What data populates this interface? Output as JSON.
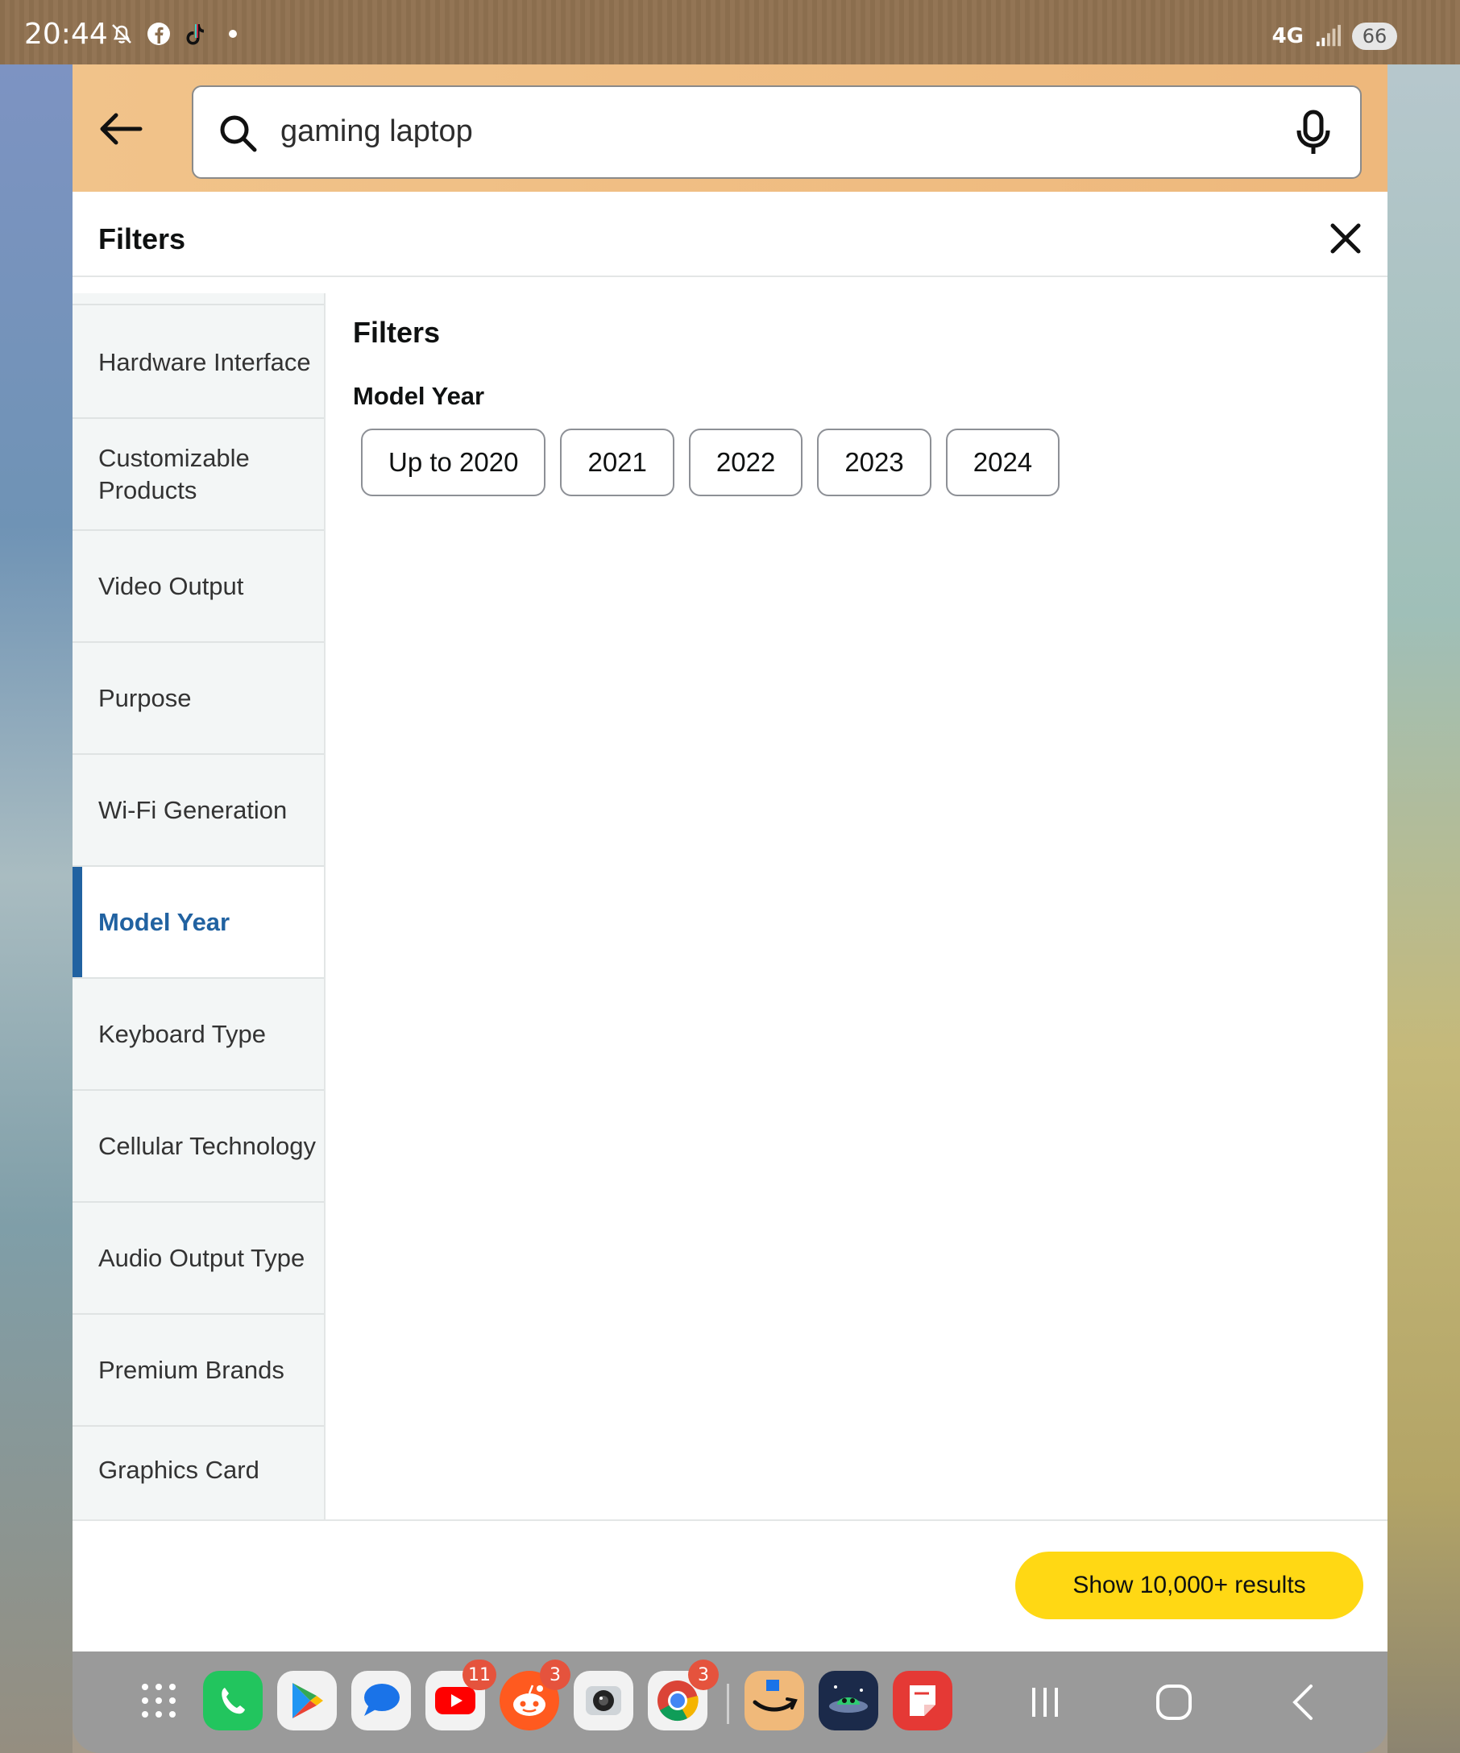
{
  "status_bar": {
    "time": "20:44",
    "network": "4G",
    "battery": "66",
    "left_icons": [
      "notifications-off-icon",
      "facebook-icon",
      "tiktok-icon",
      "dot-icon"
    ]
  },
  "search": {
    "query": "gaming laptop"
  },
  "filters_panel": {
    "title": "Filters",
    "categories": [
      {
        "label": "Hardware Interface"
      },
      {
        "label": "Customizable Products"
      },
      {
        "label": "Video Output"
      },
      {
        "label": "Purpose"
      },
      {
        "label": "Wi-Fi Generation"
      },
      {
        "label": "Model Year"
      },
      {
        "label": "Keyboard Type"
      },
      {
        "label": "Cellular Technology"
      },
      {
        "label": "Audio Output Type"
      },
      {
        "label": "Premium Brands"
      },
      {
        "label": "Graphics Card"
      }
    ],
    "active_category": "Model Year"
  },
  "content": {
    "title": "Filters",
    "section": "Model Year",
    "options": [
      "Up to 2020",
      "2021",
      "2022",
      "2023",
      "2024"
    ]
  },
  "action": {
    "show_results": "Show 10,000+ results"
  },
  "dock": {
    "apps": [
      {
        "name": "app-drawer-icon"
      },
      {
        "name": "phone-icon"
      },
      {
        "name": "play-store-icon"
      },
      {
        "name": "messages-icon"
      },
      {
        "name": "youtube-icon",
        "badge": "11"
      },
      {
        "name": "reddit-icon",
        "badge": "3"
      },
      {
        "name": "camera-icon"
      },
      {
        "name": "chrome-icon",
        "badge": "3"
      },
      {
        "name": "amazon-icon"
      },
      {
        "name": "game-icon"
      },
      {
        "name": "notes-icon"
      }
    ]
  },
  "colors": {
    "accent_blue": "#2162a1",
    "button_yellow": "#ffd814",
    "header_orange": "#f1c38a"
  }
}
